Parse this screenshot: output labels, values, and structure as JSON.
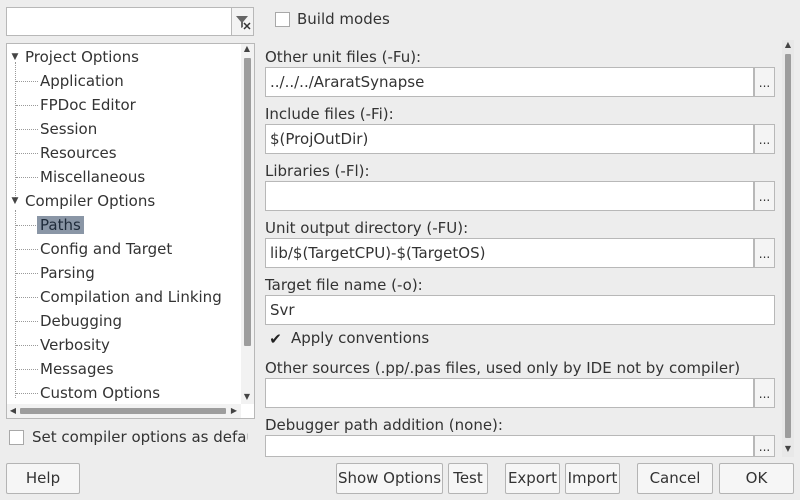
{
  "filter": {
    "value": ""
  },
  "build_modes": {
    "label": "Build modes",
    "checked": false
  },
  "tree": {
    "items": [
      {
        "label": "Project Options",
        "level": 0,
        "expanded": true
      },
      {
        "label": "Application",
        "level": 1
      },
      {
        "label": "FPDoc Editor",
        "level": 1
      },
      {
        "label": "Session",
        "level": 1
      },
      {
        "label": "Resources",
        "level": 1
      },
      {
        "label": "Miscellaneous",
        "level": 1
      },
      {
        "label": "Compiler Options",
        "level": 0,
        "expanded": true
      },
      {
        "label": "Paths",
        "level": 1,
        "selected": true
      },
      {
        "label": "Config and Target",
        "level": 1
      },
      {
        "label": "Parsing",
        "level": 1
      },
      {
        "label": "Compilation and Linking",
        "level": 1
      },
      {
        "label": "Debugging",
        "level": 1
      },
      {
        "label": "Verbosity",
        "level": 1
      },
      {
        "label": "Messages",
        "level": 1
      },
      {
        "label": "Custom Options",
        "level": 1
      }
    ]
  },
  "set_compiler_default": {
    "label": "Set compiler options as defaul",
    "checked": false
  },
  "fields": {
    "other_unit_files": {
      "label": "Other unit files (-Fu):",
      "value": "../../../AraratSynapse",
      "browse": "..."
    },
    "include_files": {
      "label": "Include files (-Fi):",
      "value": "$(ProjOutDir)",
      "browse": "..."
    },
    "libraries": {
      "label": "Libraries (-Fl):",
      "value": "",
      "browse": "..."
    },
    "unit_output_dir": {
      "label": "Unit output directory (-FU):",
      "value": "lib/$(TargetCPU)-$(TargetOS)",
      "browse": "..."
    },
    "target_file_name": {
      "label": "Target file name (-o):",
      "value": "Svr"
    },
    "apply_conventions": {
      "label": "Apply conventions",
      "checked": true
    },
    "other_sources": {
      "label": "Other sources (.pp/.pas files, used only by IDE not by compiler)",
      "value": "",
      "browse": "..."
    },
    "debugger_path": {
      "label": "Debugger path addition (none):",
      "value": "",
      "browse": "..."
    }
  },
  "buttons": {
    "help": "Help",
    "show_options": "Show Options",
    "test": "Test",
    "export": "Export",
    "import": "Import",
    "cancel": "Cancel",
    "ok": "OK"
  }
}
